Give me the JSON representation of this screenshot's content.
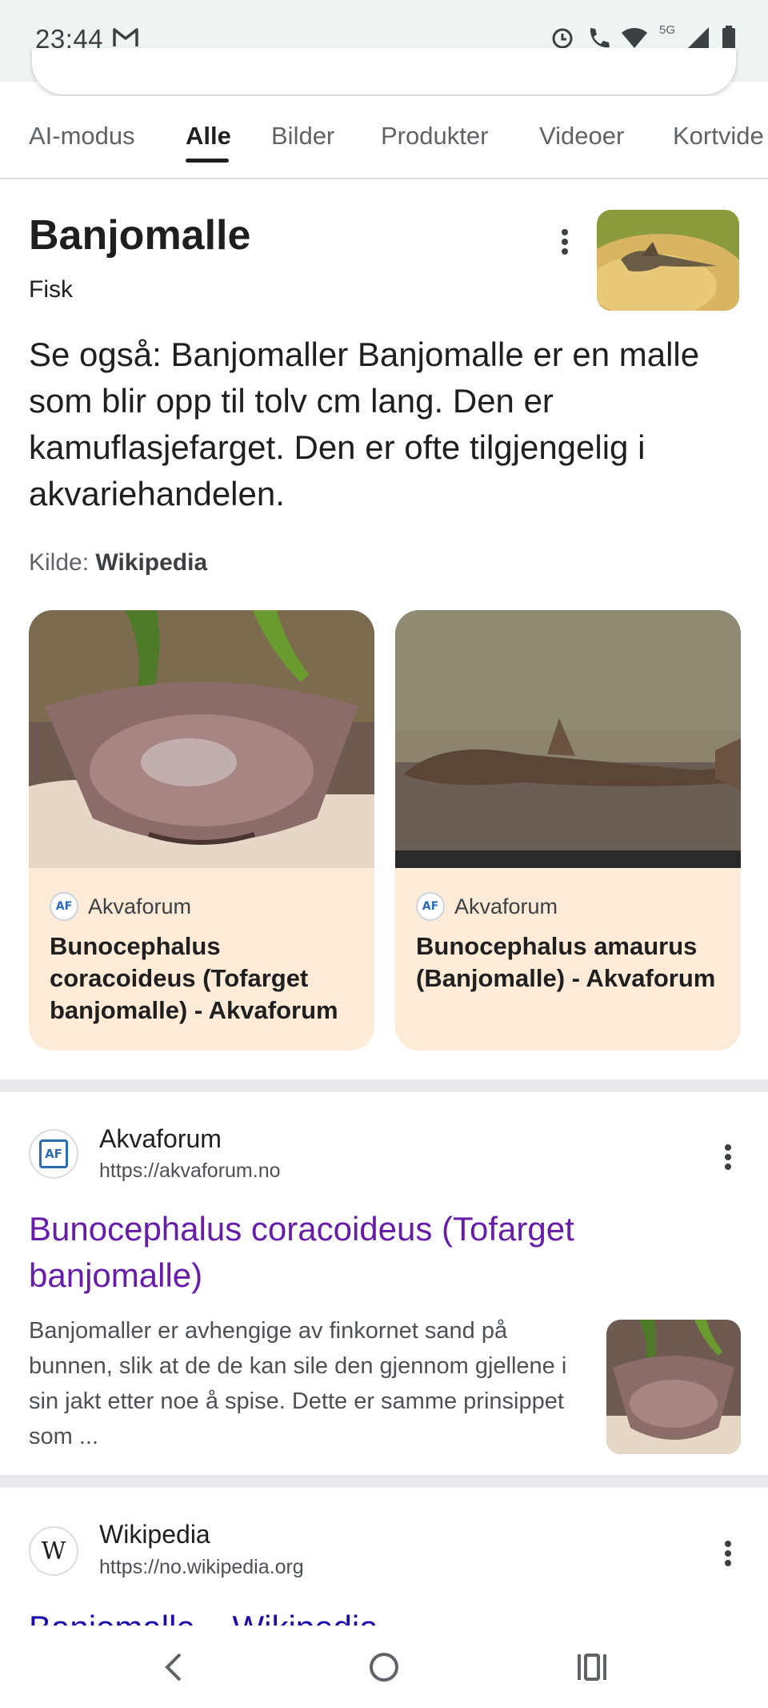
{
  "status": {
    "time": "23:44",
    "network": "5G"
  },
  "tabs": [
    "AI-modus",
    "Alle",
    "Bilder",
    "Produkter",
    "Videoer",
    "Kortvide"
  ],
  "knowledge_panel": {
    "title": "Banjomalle",
    "subtitle": "Fisk",
    "description": "Se også: Banjomaller Banjomalle er en malle som blir opp til tolv cm lang. Den er kamuflasjefarget. Den er ofte tilgjengelig i akvariehandelen.",
    "source_label": "Kilde:",
    "source_name": "Wikipedia"
  },
  "cards": [
    {
      "site": "Akvaforum",
      "favicon_text": "AF",
      "title": "Bunocephalus coracoideus (Tofarget banjomalle) - Akvaforum"
    },
    {
      "site": "Akvaforum",
      "favicon_text": "AF",
      "title": "Bunocephalus amaurus (Banjomalle) - Akvaforum"
    }
  ],
  "results": [
    {
      "site": "Akvaforum",
      "url": "https://akvaforum.no",
      "favicon_text": "AF",
      "title": "Bunocephalus coracoideus (Tofarget banjomalle)",
      "snippet": "Banjomaller er avhengige av finkornet sand på bunnen, slik at de de kan sile den gjennom gjellene i sin jakt etter noe å spise. Dette er samme prinsippet som ..."
    },
    {
      "site": "Wikipedia",
      "url": "https://no.wikipedia.org",
      "favicon_text": "W",
      "title": "Banjomalle – Wikipedia"
    }
  ],
  "colors": {
    "visited_link": "#681da8",
    "link": "#1a0dab",
    "card_bg": "#fdebd8",
    "status_bg": "#eef4f1"
  }
}
